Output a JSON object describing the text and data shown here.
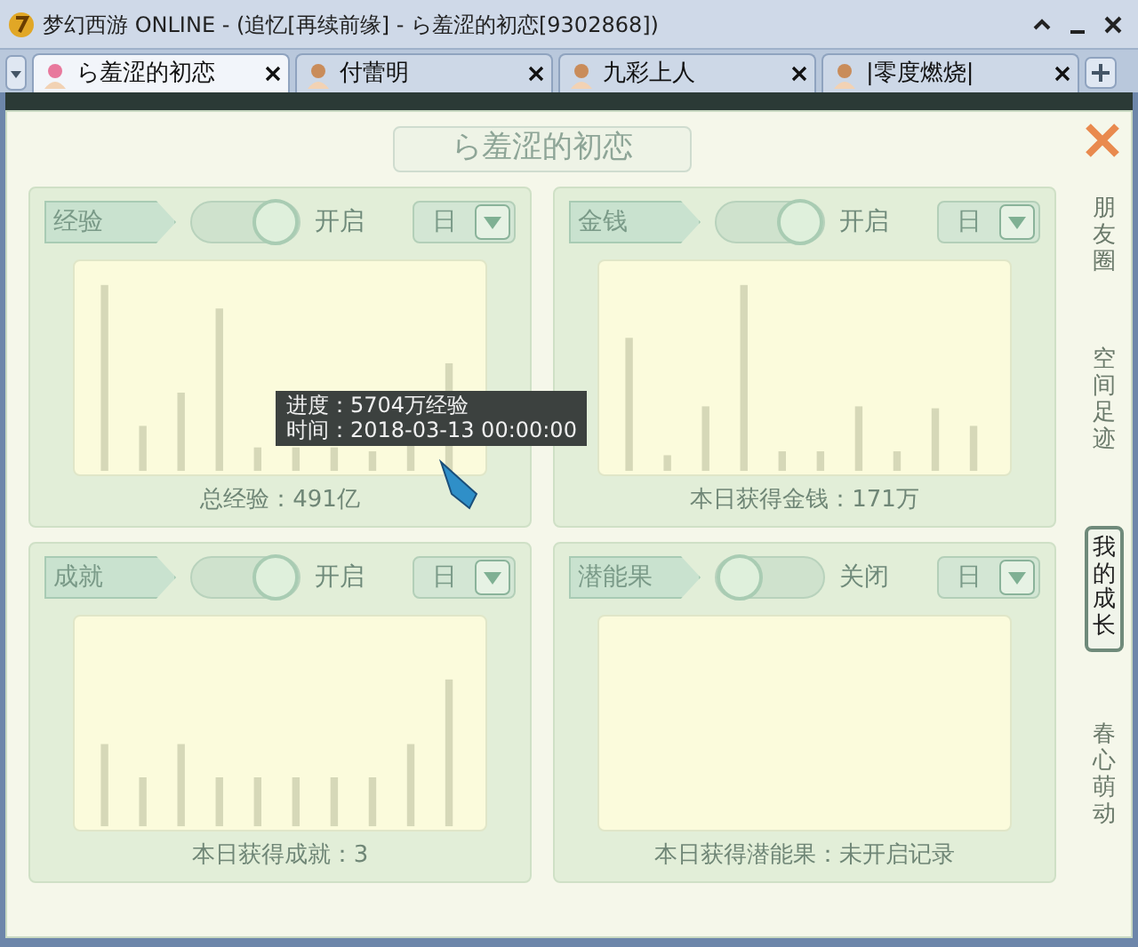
{
  "window": {
    "title": "梦幻西游 ONLINE - (追忆[再续前缘] - ら羞涩的初恋[9302868])"
  },
  "tabs": [
    {
      "label": "ら羞涩的初恋",
      "selected": true
    },
    {
      "label": "付蕾明",
      "selected": false
    },
    {
      "label": "九彩上人",
      "selected": false
    },
    {
      "label": "|零度燃烧|",
      "selected": false
    }
  ],
  "panel": {
    "title": "ら羞涩的初恋"
  },
  "cards": [
    {
      "name": "经验",
      "on": true,
      "toggle_label": "开启",
      "period": "日",
      "footer": "总经验：491亿"
    },
    {
      "name": "金钱",
      "on": true,
      "toggle_label": "开启",
      "period": "日",
      "footer": "本日获得金钱：171万"
    },
    {
      "name": "成就",
      "on": true,
      "toggle_label": "开启",
      "period": "日",
      "footer": "本日获得成就：3"
    },
    {
      "name": "潜能果",
      "on": false,
      "toggle_label": "关闭",
      "period": "日",
      "footer": "本日获得潜能果：未开启记录"
    }
  ],
  "tooltip": {
    "lines": [
      "进度：5704万经验",
      "时间：2018-03-13 00:00:00"
    ]
  },
  "side_tabs": [
    {
      "label": "朋友圈",
      "selected": false
    },
    {
      "label": "空间足迹",
      "selected": false
    },
    {
      "label": "我的成长",
      "selected": true
    },
    {
      "label": "春心萌动",
      "selected": false
    }
  ]
}
